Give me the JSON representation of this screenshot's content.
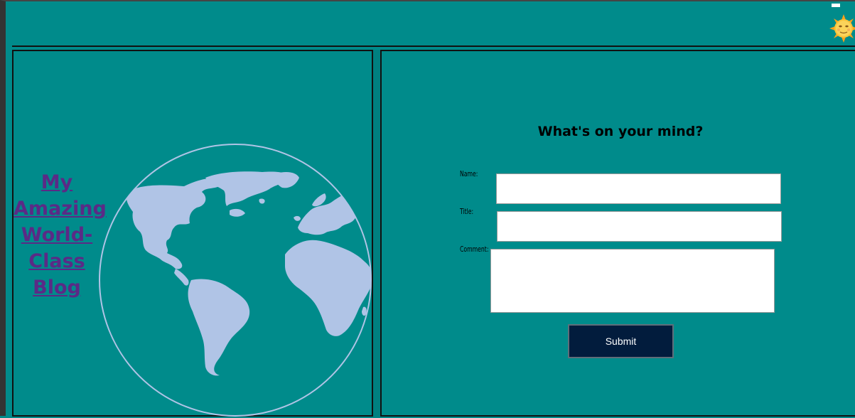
{
  "header": {
    "theme_toggle_icon": "sun-with-face-icon"
  },
  "blog": {
    "title_lines": [
      "My",
      "Amazing",
      "World-",
      "Class",
      "Blog"
    ],
    "globe_icon": "world-map-globe-icon"
  },
  "form": {
    "heading": "What's on your mind?",
    "name_label": "Name:",
    "name_value": "",
    "title_label": "Title:",
    "title_value": "",
    "comment_label": "Comment:",
    "comment_value": "",
    "submit_label": "Submit"
  },
  "colors": {
    "background": "#008b8b",
    "land": "#b0c4e6",
    "title_link": "#5b2a86",
    "button": "#021c3d"
  }
}
